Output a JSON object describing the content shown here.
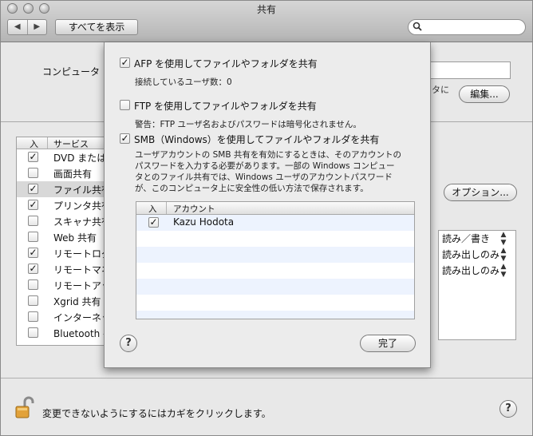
{
  "window": {
    "title": "共有"
  },
  "toolbar": {
    "back_label": "◀",
    "forward_label": "▶",
    "show_all_label": "すべてを表示",
    "search": {
      "value": ""
    }
  },
  "pane": {
    "computer_name_label": "コンピュータ",
    "computer_name_value": "",
    "description_fragment": "タに",
    "edit_button": "編集...",
    "services_header": {
      "on": "入",
      "service": "サービス"
    },
    "services": [
      {
        "label": "DVD または",
        "checked": true
      },
      {
        "label": "画面共有",
        "checked": false
      },
      {
        "label": "ファイル共有",
        "checked": true,
        "selected": true
      },
      {
        "label": "プリンタ共有",
        "checked": true
      },
      {
        "label": "スキャナ共有",
        "checked": false
      },
      {
        "label": "Web 共有",
        "checked": false
      },
      {
        "label": "リモートログイン",
        "checked": true
      },
      {
        "label": "リモートマネージメント",
        "checked": true
      },
      {
        "label": "リモートアップルイベント",
        "checked": false
      },
      {
        "label": "Xgrid 共有",
        "checked": false
      },
      {
        "label": "インターネット共有",
        "checked": false
      },
      {
        "label": "Bluetooth 共有",
        "checked": false
      }
    ],
    "options_button": "オプション...",
    "permissions": [
      "読み／書き",
      "読み出しのみ",
      "読み出しのみ"
    ],
    "lock_text": "変更できないようにするにはカギをクリックします。",
    "help_label": "?"
  },
  "sheet": {
    "afp": {
      "label": "AFP を使用してファイルやフォルダを共有",
      "checked": true,
      "note": "接続しているユーザ数：0"
    },
    "ftp": {
      "label": "FTP を使用してファイルやフォルダを共有",
      "checked": false,
      "note": "警告：FTP ユーザ名およびパスワードは暗号化されません。"
    },
    "smb": {
      "label": "SMB（Windows）を使用してファイルやフォルダを共有",
      "checked": true,
      "description": [
        "ユーザアカウントの SMB 共有を有効にするときは、そのアカウントの",
        "パスワードを入力する必要があります。一部の Windows コンピュー",
        "タとのファイル共有では、Windows ユーザのアカウントパスワード",
        "が、このコンピュータ上に安全性の低い方法で保存されます。"
      ]
    },
    "accounts_header": {
      "on": "入",
      "account": "アカウント"
    },
    "accounts": [
      {
        "name": "Kazu Hodota",
        "checked": true
      }
    ],
    "help_label": "?",
    "done_button": "完了"
  }
}
